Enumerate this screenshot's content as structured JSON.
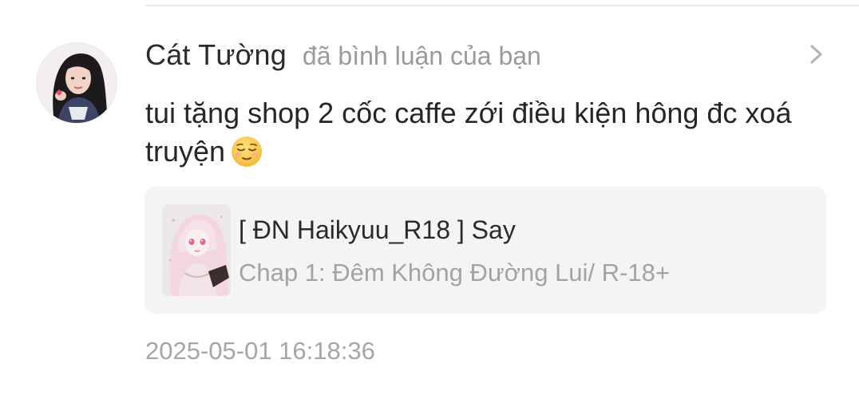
{
  "notification": {
    "username": "Cát Tường",
    "action_text": "đã bình luận của bạn",
    "comment_text": "tui tặng shop 2 cốc caffe zới điều kiện hông đc xoá truyện",
    "comment_emoji": "relieved-face-emoji",
    "story_card": {
      "title": "[ ĐN Haikyuu_R18 ] Say",
      "subtitle": "Chap 1: Đêm Không Đường Lui/ R-18+"
    },
    "timestamp": "2025-05-01 16:18:36"
  },
  "icons": {
    "avatar": "user-avatar-photo",
    "chevron": "chevron-right-icon",
    "story_cover": "story-cover-image"
  },
  "colors": {
    "username": "#2b2b2b",
    "muted_text": "#9a9a9a",
    "card_background": "#f4f4f5",
    "divider": "#e9e9ea"
  }
}
